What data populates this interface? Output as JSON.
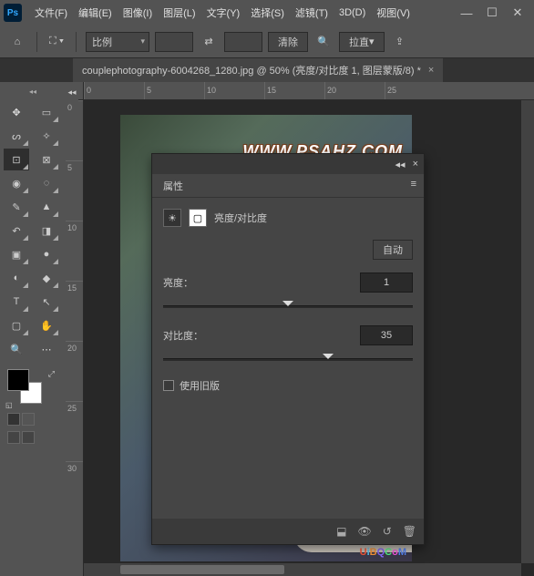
{
  "app": {
    "logo": "Ps"
  },
  "menu": {
    "file": "文件(F)",
    "edit": "编辑(E)",
    "image": "图像(I)",
    "layer": "图层(L)",
    "type": "文字(Y)",
    "select": "选择(S)",
    "filter": "滤镜(T)",
    "threeD": "3D(D)",
    "view": "视图(V)"
  },
  "win": {
    "min": "—",
    "max": "☐",
    "close": "✕"
  },
  "options": {
    "ratio_label": "比例",
    "clear": "清除",
    "straighten": "拉直",
    "swap": "⇄"
  },
  "tab": {
    "title": "couplephotography-6004268_1280.jpg @ 50% (亮度/对比度 1, 图层蒙版/8) *",
    "close": "×"
  },
  "ruler_h": [
    "0",
    "5",
    "10",
    "15",
    "20",
    "25"
  ],
  "ruler_v": [
    "0",
    "5",
    "10",
    "15",
    "20",
    "25",
    "30"
  ],
  "watermark": "WWW.PSAHZ.COM",
  "watermark2": {
    "u": "U",
    "i": "i",
    "b": "B",
    "q": "Q",
    ".": ".",
    "c": "C",
    "o": "o",
    "m": "M"
  },
  "panel": {
    "title": "属性",
    "adj_name": "亮度/对比度",
    "auto": "自动",
    "brightness_label": "亮度：",
    "brightness_value": "1",
    "contrast_label": "对比度：",
    "contrast_value": "35",
    "legacy": "使用旧版",
    "collapse": "◂◂",
    "close": "×",
    "menu": "≡"
  },
  "tools": {
    "move": "✥",
    "marquee": "▭",
    "lasso": "ᔕ",
    "wand": "✧",
    "crop": "⊡",
    "slice": "⊠",
    "eyedrop": "◉",
    "patch": "◌",
    "brush": "✎",
    "stamp": "▲",
    "history": "↶",
    "eraser": "◨",
    "fill": "▣",
    "blur": "●",
    "dodge": "◐",
    "pen": "◆",
    "type": "T",
    "path": "↖",
    "shape": "▢",
    "hand": "✋",
    "zoom": "🔍",
    "more": "⋯"
  },
  "foot": {
    "mask": "◙",
    "view": "👁",
    "reset": "↺",
    "delete": "🗑"
  }
}
